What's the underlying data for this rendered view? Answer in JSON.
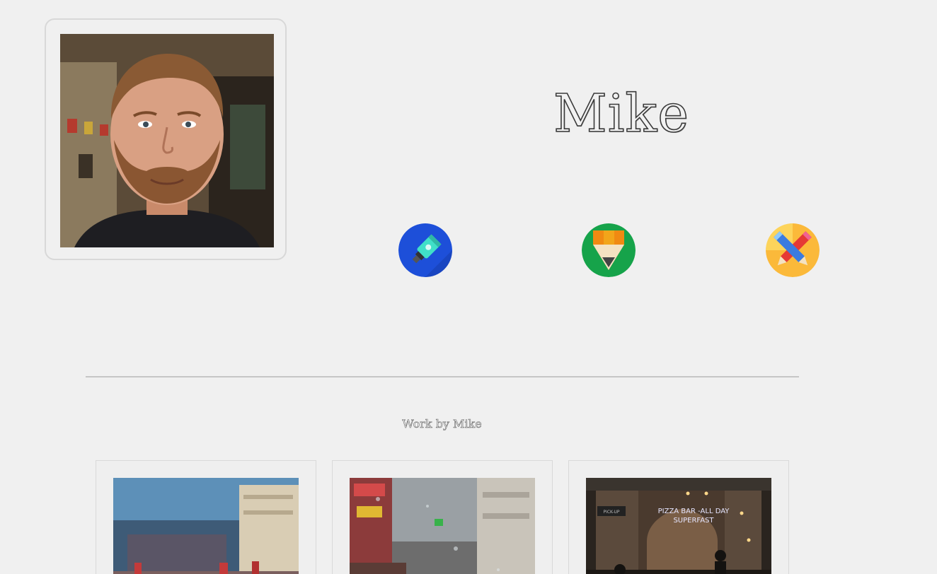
{
  "profile": {
    "name": "Mike",
    "photo_alt": "Mike"
  },
  "skills": [
    {
      "icon": "paint-tube-icon",
      "bg": "#1d4fd9"
    },
    {
      "icon": "pencil-tip-icon",
      "bg": "#16a34a"
    },
    {
      "icon": "crossed-pencils-icon",
      "bg": "#fbb93a"
    }
  ],
  "work": {
    "title": "Work by Mike",
    "items": [
      {
        "image": "piccadilly-painting"
      },
      {
        "image": "rainy-street-window"
      },
      {
        "image": "pizza-bar-storefront",
        "sign_line1": "PIZZA BAR -ALL DAY",
        "sign_line2": "SUPERFAST",
        "sign_small": "PICK-UP"
      }
    ]
  }
}
